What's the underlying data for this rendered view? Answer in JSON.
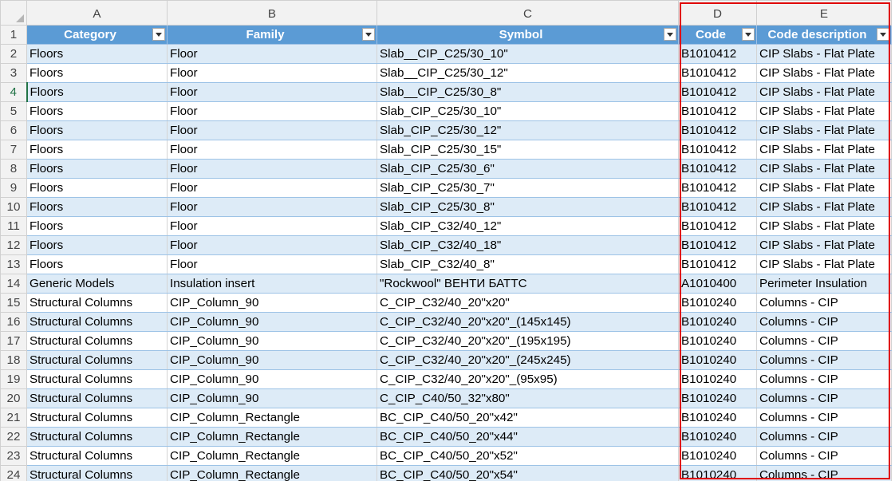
{
  "sheet": {
    "column_letters": [
      "A",
      "B",
      "C",
      "D",
      "E"
    ],
    "headers": [
      "Category",
      "Family",
      "Symbol",
      "Code",
      "Code description"
    ],
    "header_row_number": "1",
    "active_row_number": "4",
    "rows": [
      {
        "n": "2",
        "a": "Floors",
        "b": "Floor",
        "c": "Slab__CIP_C25/30_10\"",
        "d": "B1010412",
        "e": "CIP Slabs - Flat Plate"
      },
      {
        "n": "3",
        "a": "Floors",
        "b": "Floor",
        "c": "Slab__CIP_C25/30_12\"",
        "d": "B1010412",
        "e": "CIP Slabs - Flat Plate"
      },
      {
        "n": "4",
        "a": "Floors",
        "b": "Floor",
        "c": "Slab__CIP_C25/30_8\"",
        "d": "B1010412",
        "e": "CIP Slabs - Flat Plate"
      },
      {
        "n": "5",
        "a": "Floors",
        "b": "Floor",
        "c": "Slab_CIP_C25/30_10\"",
        "d": "B1010412",
        "e": "CIP Slabs - Flat Plate"
      },
      {
        "n": "6",
        "a": "Floors",
        "b": "Floor",
        "c": "Slab_CIP_C25/30_12\"",
        "d": "B1010412",
        "e": "CIP Slabs - Flat Plate"
      },
      {
        "n": "7",
        "a": "Floors",
        "b": "Floor",
        "c": "Slab_CIP_C25/30_15\"",
        "d": "B1010412",
        "e": "CIP Slabs - Flat Plate"
      },
      {
        "n": "8",
        "a": "Floors",
        "b": "Floor",
        "c": "Slab_CIP_C25/30_6\"",
        "d": "B1010412",
        "e": "CIP Slabs - Flat Plate"
      },
      {
        "n": "9",
        "a": "Floors",
        "b": "Floor",
        "c": "Slab_CIP_C25/30_7\"",
        "d": "B1010412",
        "e": "CIP Slabs - Flat Plate"
      },
      {
        "n": "10",
        "a": "Floors",
        "b": "Floor",
        "c": "Slab_CIP_C25/30_8\"",
        "d": "B1010412",
        "e": "CIP Slabs - Flat Plate"
      },
      {
        "n": "11",
        "a": "Floors",
        "b": "Floor",
        "c": "Slab_CIP_C32/40_12\"",
        "d": "B1010412",
        "e": "CIP Slabs - Flat Plate"
      },
      {
        "n": "12",
        "a": "Floors",
        "b": "Floor",
        "c": "Slab_CIP_C32/40_18\"",
        "d": "B1010412",
        "e": "CIP Slabs - Flat Plate"
      },
      {
        "n": "13",
        "a": "Floors",
        "b": "Floor",
        "c": "Slab_CIP_C32/40_8\"",
        "d": "B1010412",
        "e": "CIP Slabs - Flat Plate"
      },
      {
        "n": "14",
        "a": "Generic Models",
        "b": "Insulation insert",
        "c": "\"Rockwool\" ВЕНТИ БАТТС",
        "d": "A1010400",
        "e": "Perimeter Insulation"
      },
      {
        "n": "15",
        "a": "Structural Columns",
        "b": "CIP_Column_90",
        "c": "C_CIP_C32/40_20\"x20\"",
        "d": "B1010240",
        "e": "Columns - CIP"
      },
      {
        "n": "16",
        "a": "Structural Columns",
        "b": "CIP_Column_90",
        "c": "C_CIP_C32/40_20\"x20\"_(145x145)",
        "d": "B1010240",
        "e": "Columns - CIP"
      },
      {
        "n": "17",
        "a": "Structural Columns",
        "b": "CIP_Column_90",
        "c": "C_CIP_C32/40_20\"x20\"_(195x195)",
        "d": "B1010240",
        "e": "Columns - CIP"
      },
      {
        "n": "18",
        "a": "Structural Columns",
        "b": "CIP_Column_90",
        "c": "C_CIP_C32/40_20\"x20\"_(245x245)",
        "d": "B1010240",
        "e": "Columns - CIP"
      },
      {
        "n": "19",
        "a": "Structural Columns",
        "b": "CIP_Column_90",
        "c": "C_CIP_C32/40_20\"x20\"_(95x95)",
        "d": "B1010240",
        "e": "Columns - CIP"
      },
      {
        "n": "20",
        "a": "Structural Columns",
        "b": "CIP_Column_90",
        "c": "C_CIP_C40/50_32\"x80\"",
        "d": "B1010240",
        "e": "Columns - CIP"
      },
      {
        "n": "21",
        "a": "Structural Columns",
        "b": "CIP_Column_Rectangle",
        "c": "BC_CIP_C40/50_20\"x42\"",
        "d": "B1010240",
        "e": "Columns - CIP"
      },
      {
        "n": "22",
        "a": "Structural Columns",
        "b": "CIP_Column_Rectangle",
        "c": "BC_CIP_C40/50_20\"x44\"",
        "d": "B1010240",
        "e": "Columns - CIP"
      },
      {
        "n": "23",
        "a": "Structural Columns",
        "b": "CIP_Column_Rectangle",
        "c": "BC_CIP_C40/50_20\"x52\"",
        "d": "B1010240",
        "e": "Columns - CIP"
      },
      {
        "n": "24",
        "a": "Structural Columns",
        "b": "CIP_Column_Rectangle",
        "c": "BC_CIP_C40/50_20\"x54\"",
        "d": "B1010240",
        "e": "Columns - CIP"
      }
    ]
  },
  "colors": {
    "header_fill": "#5b9bd5",
    "band_fill": "#ddebf7",
    "highlight_box": "#e00000"
  }
}
